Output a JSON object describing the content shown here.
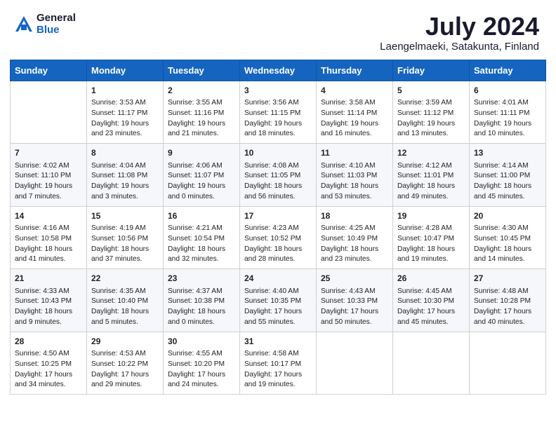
{
  "header": {
    "logo_general": "General",
    "logo_blue": "Blue",
    "month_year": "July 2024",
    "location": "Laengelmaeki, Satakunta, Finland"
  },
  "weekdays": [
    "Sunday",
    "Monday",
    "Tuesday",
    "Wednesday",
    "Thursday",
    "Friday",
    "Saturday"
  ],
  "weeks": [
    [
      {
        "day": "",
        "info": ""
      },
      {
        "day": "1",
        "info": "Sunrise: 3:53 AM\nSunset: 11:17 PM\nDaylight: 19 hours\nand 23 minutes."
      },
      {
        "day": "2",
        "info": "Sunrise: 3:55 AM\nSunset: 11:16 PM\nDaylight: 19 hours\nand 21 minutes."
      },
      {
        "day": "3",
        "info": "Sunrise: 3:56 AM\nSunset: 11:15 PM\nDaylight: 19 hours\nand 18 minutes."
      },
      {
        "day": "4",
        "info": "Sunrise: 3:58 AM\nSunset: 11:14 PM\nDaylight: 19 hours\nand 16 minutes."
      },
      {
        "day": "5",
        "info": "Sunrise: 3:59 AM\nSunset: 11:12 PM\nDaylight: 19 hours\nand 13 minutes."
      },
      {
        "day": "6",
        "info": "Sunrise: 4:01 AM\nSunset: 11:11 PM\nDaylight: 19 hours\nand 10 minutes."
      }
    ],
    [
      {
        "day": "7",
        "info": "Sunrise: 4:02 AM\nSunset: 11:10 PM\nDaylight: 19 hours\nand 7 minutes."
      },
      {
        "day": "8",
        "info": "Sunrise: 4:04 AM\nSunset: 11:08 PM\nDaylight: 19 hours\nand 3 minutes."
      },
      {
        "day": "9",
        "info": "Sunrise: 4:06 AM\nSunset: 11:07 PM\nDaylight: 19 hours\nand 0 minutes."
      },
      {
        "day": "10",
        "info": "Sunrise: 4:08 AM\nSunset: 11:05 PM\nDaylight: 18 hours\nand 56 minutes."
      },
      {
        "day": "11",
        "info": "Sunrise: 4:10 AM\nSunset: 11:03 PM\nDaylight: 18 hours\nand 53 minutes."
      },
      {
        "day": "12",
        "info": "Sunrise: 4:12 AM\nSunset: 11:01 PM\nDaylight: 18 hours\nand 49 minutes."
      },
      {
        "day": "13",
        "info": "Sunrise: 4:14 AM\nSunset: 11:00 PM\nDaylight: 18 hours\nand 45 minutes."
      }
    ],
    [
      {
        "day": "14",
        "info": "Sunrise: 4:16 AM\nSunset: 10:58 PM\nDaylight: 18 hours\nand 41 minutes."
      },
      {
        "day": "15",
        "info": "Sunrise: 4:19 AM\nSunset: 10:56 PM\nDaylight: 18 hours\nand 37 minutes."
      },
      {
        "day": "16",
        "info": "Sunrise: 4:21 AM\nSunset: 10:54 PM\nDaylight: 18 hours\nand 32 minutes."
      },
      {
        "day": "17",
        "info": "Sunrise: 4:23 AM\nSunset: 10:52 PM\nDaylight: 18 hours\nand 28 minutes."
      },
      {
        "day": "18",
        "info": "Sunrise: 4:25 AM\nSunset: 10:49 PM\nDaylight: 18 hours\nand 23 minutes."
      },
      {
        "day": "19",
        "info": "Sunrise: 4:28 AM\nSunset: 10:47 PM\nDaylight: 18 hours\nand 19 minutes."
      },
      {
        "day": "20",
        "info": "Sunrise: 4:30 AM\nSunset: 10:45 PM\nDaylight: 18 hours\nand 14 minutes."
      }
    ],
    [
      {
        "day": "21",
        "info": "Sunrise: 4:33 AM\nSunset: 10:43 PM\nDaylight: 18 hours\nand 9 minutes."
      },
      {
        "day": "22",
        "info": "Sunrise: 4:35 AM\nSunset: 10:40 PM\nDaylight: 18 hours\nand 5 minutes."
      },
      {
        "day": "23",
        "info": "Sunrise: 4:37 AM\nSunset: 10:38 PM\nDaylight: 18 hours\nand 0 minutes."
      },
      {
        "day": "24",
        "info": "Sunrise: 4:40 AM\nSunset: 10:35 PM\nDaylight: 17 hours\nand 55 minutes."
      },
      {
        "day": "25",
        "info": "Sunrise: 4:43 AM\nSunset: 10:33 PM\nDaylight: 17 hours\nand 50 minutes."
      },
      {
        "day": "26",
        "info": "Sunrise: 4:45 AM\nSunset: 10:30 PM\nDaylight: 17 hours\nand 45 minutes."
      },
      {
        "day": "27",
        "info": "Sunrise: 4:48 AM\nSunset: 10:28 PM\nDaylight: 17 hours\nand 40 minutes."
      }
    ],
    [
      {
        "day": "28",
        "info": "Sunrise: 4:50 AM\nSunset: 10:25 PM\nDaylight: 17 hours\nand 34 minutes."
      },
      {
        "day": "29",
        "info": "Sunrise: 4:53 AM\nSunset: 10:22 PM\nDaylight: 17 hours\nand 29 minutes."
      },
      {
        "day": "30",
        "info": "Sunrise: 4:55 AM\nSunset: 10:20 PM\nDaylight: 17 hours\nand 24 minutes."
      },
      {
        "day": "31",
        "info": "Sunrise: 4:58 AM\nSunset: 10:17 PM\nDaylight: 17 hours\nand 19 minutes."
      },
      {
        "day": "",
        "info": ""
      },
      {
        "day": "",
        "info": ""
      },
      {
        "day": "",
        "info": ""
      }
    ]
  ]
}
